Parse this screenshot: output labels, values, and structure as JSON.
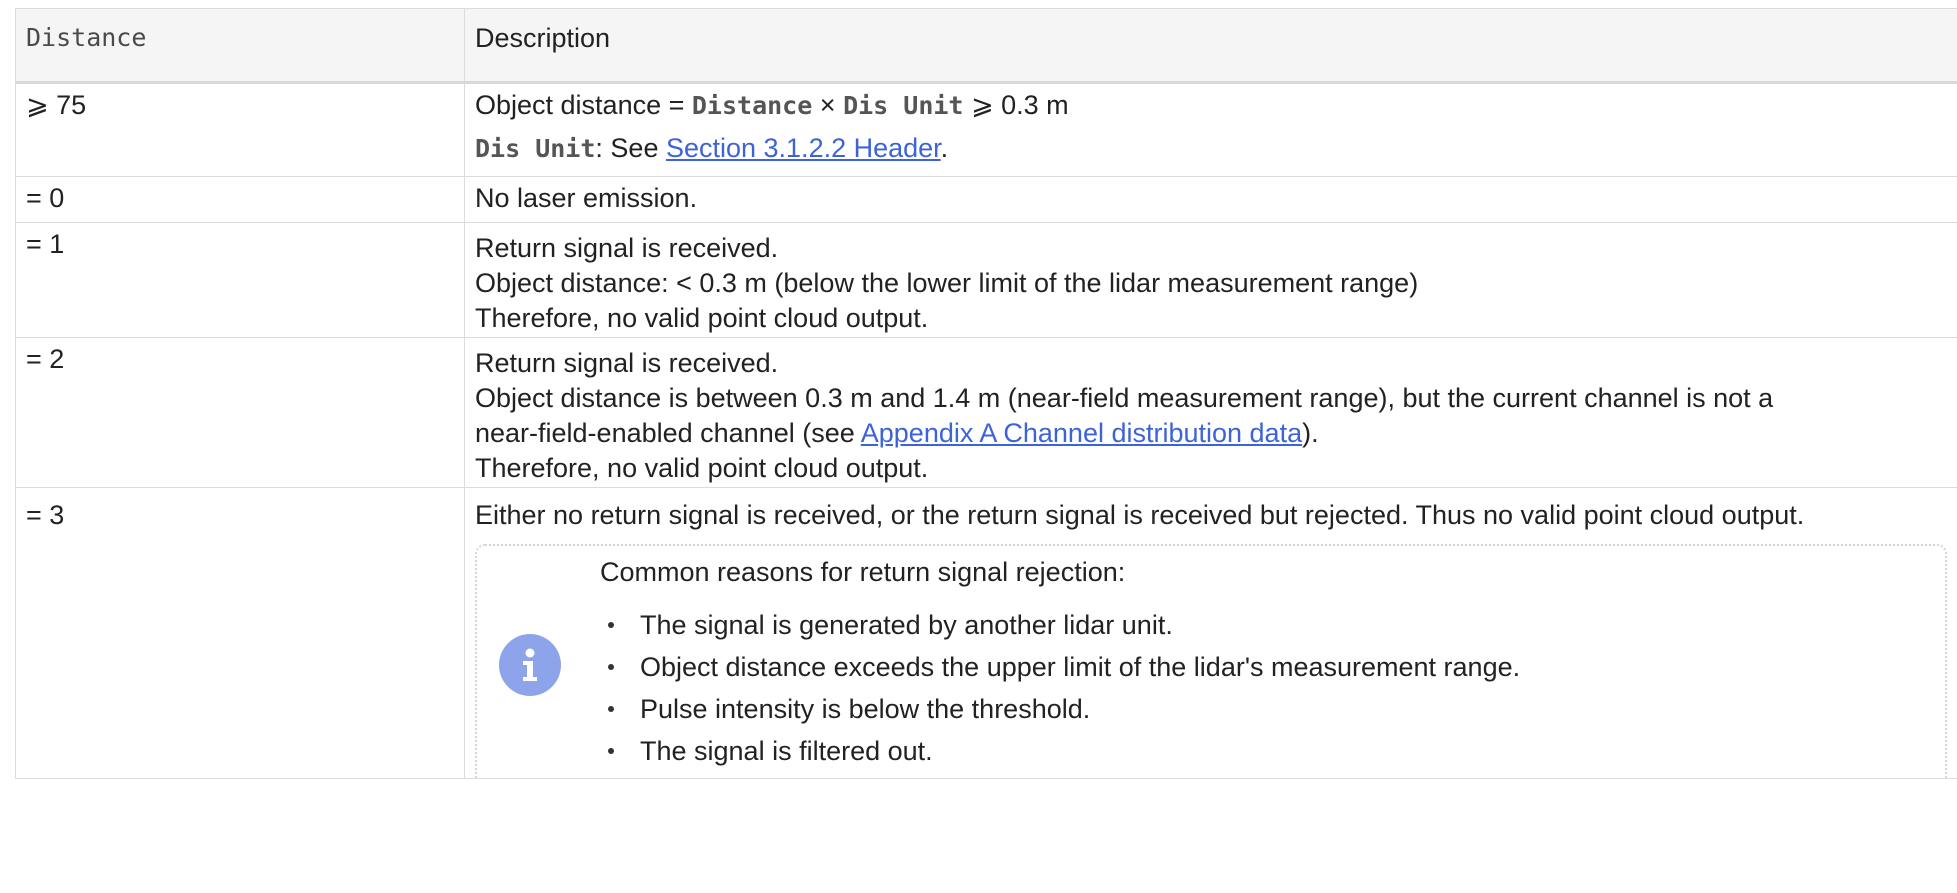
{
  "table": {
    "headers": {
      "distance": "Distance",
      "description": "Description"
    },
    "rows": [
      {
        "distance": "⩾ 75",
        "desc": {
          "l1_prefix": "Object distance = ",
          "l1_term1": "Distance",
          "l1_times": " × ",
          "l1_term2": "Dis Unit",
          "l1_suffix": " ⩾ 0.3 m",
          "l2_term": "Dis Unit",
          "l2_text": ": See ",
          "l2_link": "Section 3.1.2.2 Header",
          "l2_end": "."
        }
      },
      {
        "distance": "= 0",
        "desc": {
          "l1": "No laser emission."
        }
      },
      {
        "distance": "= 1",
        "desc": {
          "l1": "Return signal is received.",
          "l2": "Object distance: < 0.3 m (below the lower limit of the lidar measurement range)",
          "l3": "Therefore, no valid point cloud output."
        }
      },
      {
        "distance": "= 2",
        "desc": {
          "l1": "Return signal is received.",
          "l2": "Object distance is between 0.3 m and 1.4 m (near-field measurement range), but the current channel is not a",
          "l3_prefix": "near-field-enabled channel (see ",
          "l3_link": "Appendix A Channel distribution data",
          "l3_suffix": ").",
          "l4": "Therefore, no valid point cloud output."
        }
      },
      {
        "distance": "= 3",
        "desc": {
          "l1": "Either no return signal is received, or the return signal is received but rejected. Thus no valid point cloud output.",
          "note": {
            "icon": "info-icon",
            "title": "Common reasons for return signal rejection:",
            "items": [
              "The signal is generated by another lidar unit.",
              "Object distance exceeds the upper limit of the lidar's measurement range.",
              "Pulse intensity is below the threshold.",
              "The signal is filtered out."
            ]
          }
        }
      }
    ]
  },
  "colors": {
    "link": "#3d63d9",
    "info_icon": "#8ea4ea",
    "header_bg": "#f5f5f5",
    "border": "#dcdcdc"
  }
}
